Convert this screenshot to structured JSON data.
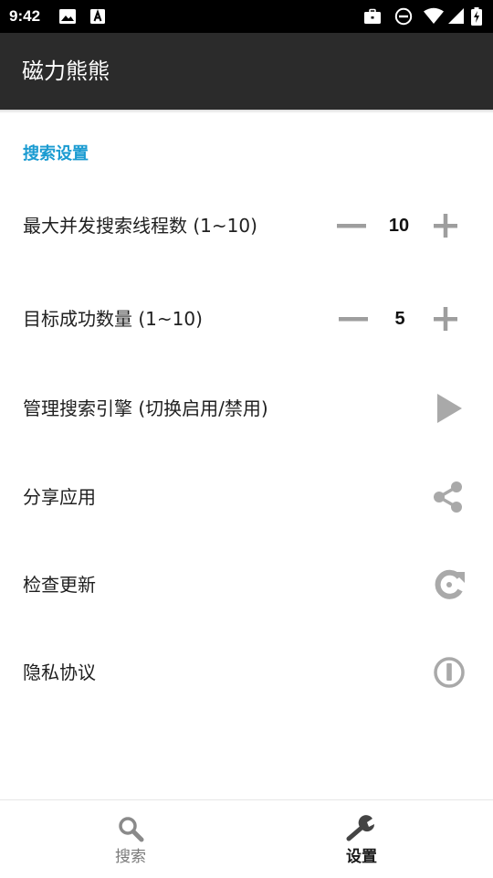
{
  "status_bar": {
    "time": "9:42",
    "icons_left": [
      "image-icon",
      "font-download-icon"
    ],
    "icons_right": [
      "work-briefcase-icon",
      "do-not-disturb-icon",
      "wifi-icon",
      "cell-signal-icon",
      "battery-charging-icon"
    ]
  },
  "app_bar": {
    "title": "磁力熊熊",
    "background_color": "#2b2b2b"
  },
  "settings": {
    "section_title": "搜索设置",
    "accent_color": "#1a9bd1",
    "rows": [
      {
        "label": "最大并发搜索线程数 (1~10)",
        "value": "10",
        "control": "stepper"
      },
      {
        "label": "目标成功数量 (1~10)",
        "value": "5",
        "control": "stepper"
      },
      {
        "label": "管理搜索引擎 (切换启用/禁用)",
        "icon": "play-arrow-icon"
      },
      {
        "label": "分享应用",
        "icon": "share-icon"
      },
      {
        "label": "检查更新",
        "icon": "refresh-icon"
      },
      {
        "label": "隐私协议",
        "icon": "info-icon"
      }
    ]
  },
  "bottom_nav": {
    "items": [
      {
        "label": "搜索",
        "icon": "search-icon",
        "active": false
      },
      {
        "label": "设置",
        "icon": "wrench-icon",
        "active": true
      }
    ]
  }
}
